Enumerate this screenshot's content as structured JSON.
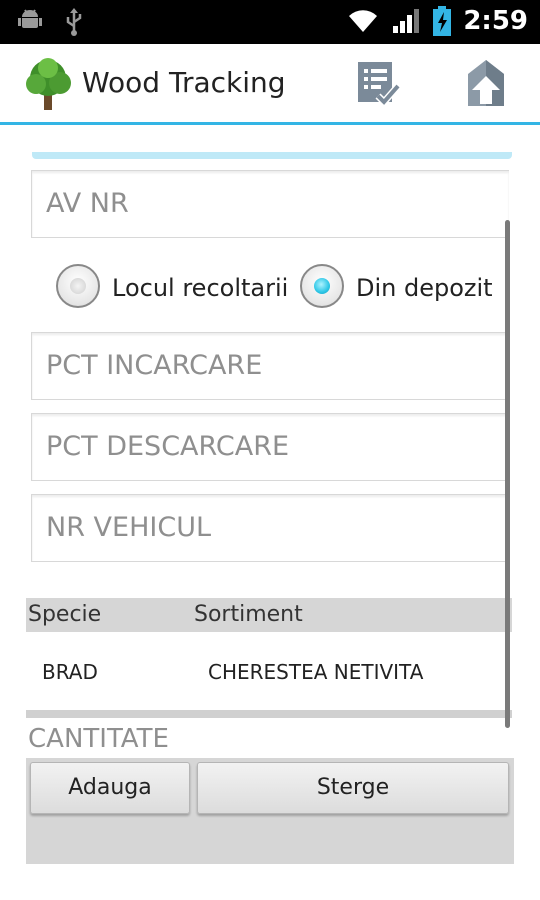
{
  "status_bar": {
    "time": "2:59",
    "icons": [
      "android-debug-icon",
      "usb-icon",
      "wifi-icon",
      "signal-icon",
      "battery-charging-icon"
    ]
  },
  "action_bar": {
    "title": "Wood Tracking",
    "logo_icon": "tree-icon",
    "actions": [
      "checklist-icon",
      "home-icon"
    ],
    "accent_color": "#33b5e5"
  },
  "form": {
    "av_nr_placeholder": "AV NR",
    "origin_options": [
      {
        "label": "Locul recoltarii",
        "selected": false
      },
      {
        "label": "Din depozit",
        "selected": true
      }
    ],
    "pct_incarcare_placeholder": "PCT INCARCARE",
    "pct_descarcare_placeholder": "PCT DESCARCARE",
    "nr_vehicul_placeholder": "NR VEHICUL"
  },
  "items_table": {
    "columns": [
      "Specie",
      "Sortiment"
    ],
    "rows": [
      {
        "specie": "BRAD",
        "sortiment": "CHERESTEA NETIVITA"
      }
    ]
  },
  "cantitate_placeholder": "CANTITATE",
  "buttons": {
    "add_label": "Adauga",
    "delete_label": "Sterge"
  }
}
